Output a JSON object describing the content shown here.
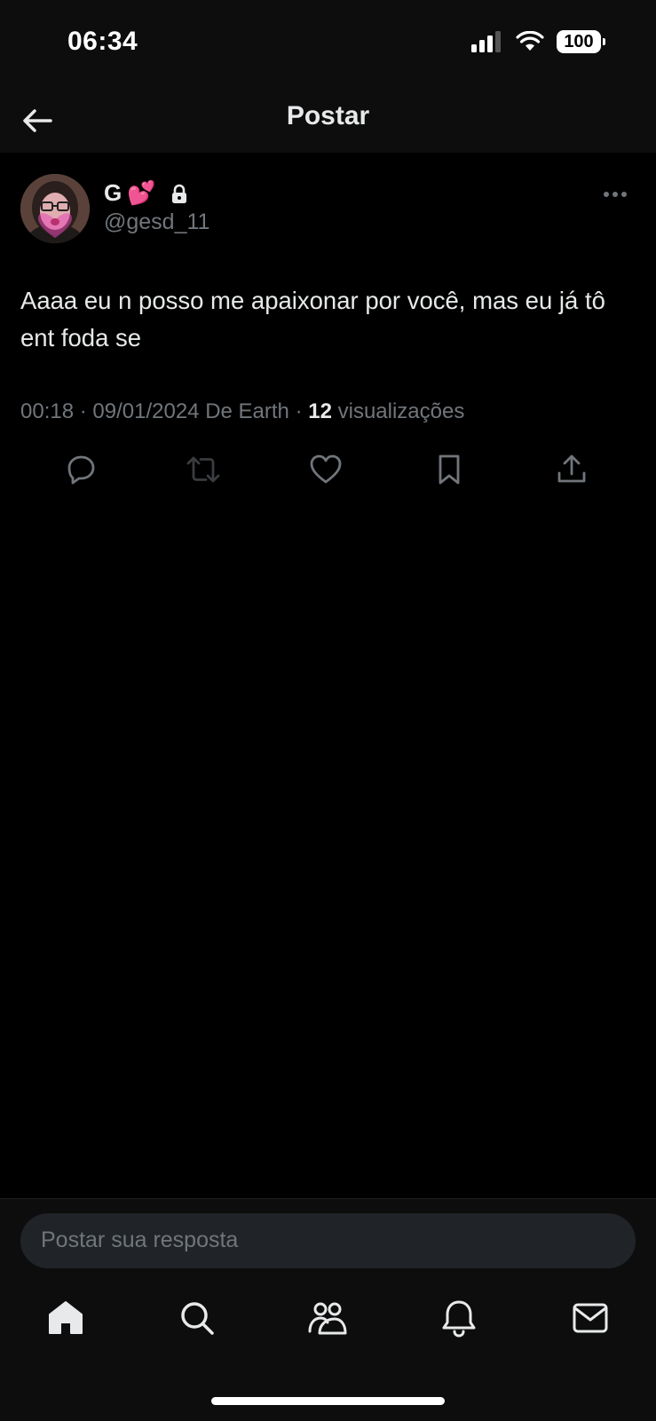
{
  "status_bar": {
    "time": "06:34",
    "battery": "100"
  },
  "header": {
    "title": "Postar"
  },
  "post": {
    "display_name": "G",
    "emoji": "💕",
    "handle": "@gesd_11",
    "text": "Aaaa eu n posso me apaixonar por você, mas eu já tô ent foda se",
    "time": "00:18",
    "date": "09/01/2024",
    "source": "De Earth",
    "views_count": "12",
    "views_label": "visualizações"
  },
  "actions": [
    "reply-icon",
    "repost-icon",
    "like-icon",
    "bookmark-icon",
    "share-icon"
  ],
  "reply": {
    "placeholder": "Postar sua resposta"
  },
  "tabbar": [
    "home-icon",
    "search-icon",
    "communities-icon",
    "notifications-icon",
    "messages-icon"
  ],
  "colors": {
    "background": "#000000",
    "bar_background": "#0d0d0d",
    "text_primary": "#e7e9ea",
    "text_secondary": "#71767b",
    "reply_box": "#202327"
  }
}
